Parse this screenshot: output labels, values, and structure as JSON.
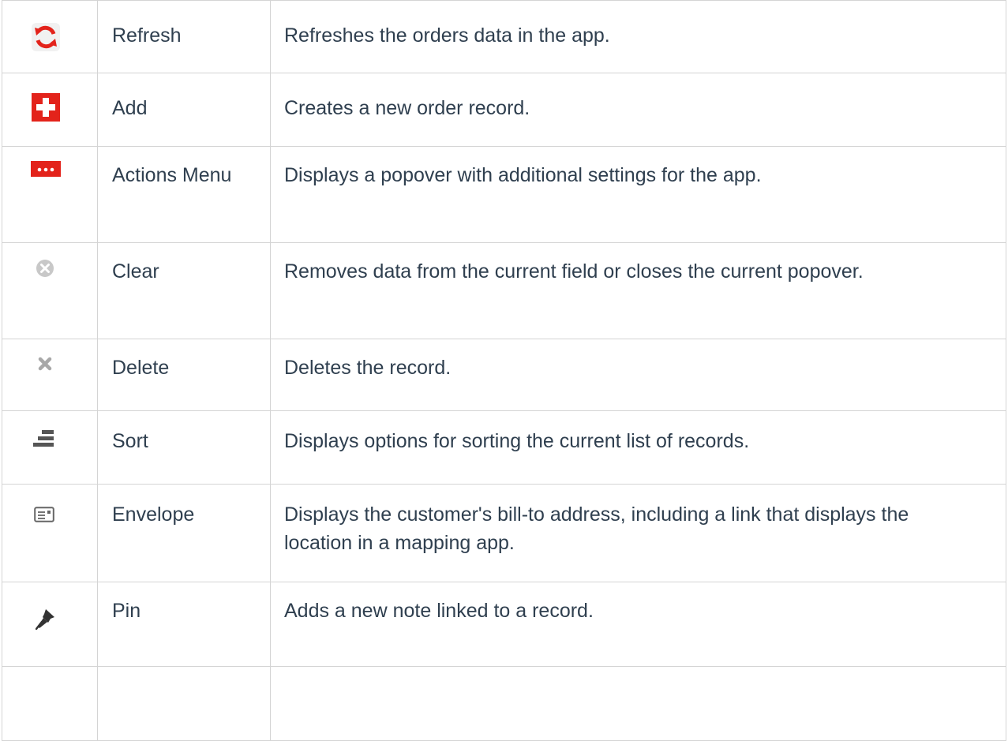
{
  "rows": [
    {
      "icon": "refresh-icon",
      "name": "Refresh",
      "description": "Refreshes the orders data in the app."
    },
    {
      "icon": "add-icon",
      "name": "Add",
      "description": "Creates a new order record."
    },
    {
      "icon": "actions-menu-icon",
      "name": "Actions Menu",
      "description": "Displays a popover with additional settings for the app."
    },
    {
      "icon": "clear-icon",
      "name": "Clear",
      "description": "Removes data from the current field or closes the current popover."
    },
    {
      "icon": "delete-icon",
      "name": "Delete",
      "description": "Deletes the record."
    },
    {
      "icon": "sort-icon",
      "name": "Sort",
      "description": "Displays options for sorting the current list of records."
    },
    {
      "icon": "envelope-icon",
      "name": "Envelope",
      "description": "Displays the customer's bill-to address, including a link that displays the location in a mapping app."
    },
    {
      "icon": "pin-icon",
      "name": "Pin",
      "description": "Adds a new note linked to a record."
    }
  ],
  "colors": {
    "accent_red": "#e3231b",
    "text": "#2f3f4f",
    "border": "#d4d4d4",
    "icon_gray": "#9a9a9a"
  }
}
